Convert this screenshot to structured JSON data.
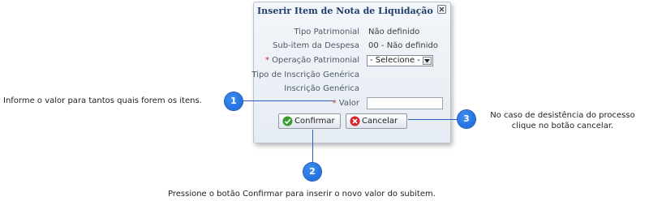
{
  "dialog": {
    "title": "Inserir Item de Nota de Liquidação",
    "fields": {
      "tipo_patrimonial_label": "Tipo Patrimonial",
      "tipo_patrimonial_value": "Não definido",
      "subitem_label": "Sub-item da Despesa",
      "subitem_value": "00 - Não definido",
      "operacao_required_mark": "*",
      "operacao_label": "Operação Patrimonial",
      "operacao_value": "- Selecione -",
      "tipo_inscricao_label": "Tipo de Inscrição Genérica",
      "inscricao_label": "Inscrição Genérica",
      "valor_required_mark": "*",
      "valor_label": "Valor",
      "valor_value": ""
    },
    "buttons": {
      "confirm": "Confirmar",
      "cancel": "Cancelar"
    }
  },
  "callouts": [
    {
      "number": "1",
      "text": "Informe o valor para tantos quais forem os itens."
    },
    {
      "number": "2",
      "text": "Pressione o botão Confirmar para inserir o novo valor do subitem."
    },
    {
      "number": "3",
      "text_line1": "No caso de desistência do processo",
      "text_line2": "clique no botão cancelar."
    }
  ],
  "colors": {
    "dialog_title": "#1f3e6a",
    "required_mark": "#c2272d",
    "callout_badge": "#1663d6",
    "confirm_icon": "#3a9b2e",
    "cancel_icon": "#d6262b"
  },
  "icons": {
    "close": "close-icon",
    "dropdown": "chevron-down-icon",
    "confirm": "check-circle-icon",
    "cancel": "x-circle-icon"
  }
}
